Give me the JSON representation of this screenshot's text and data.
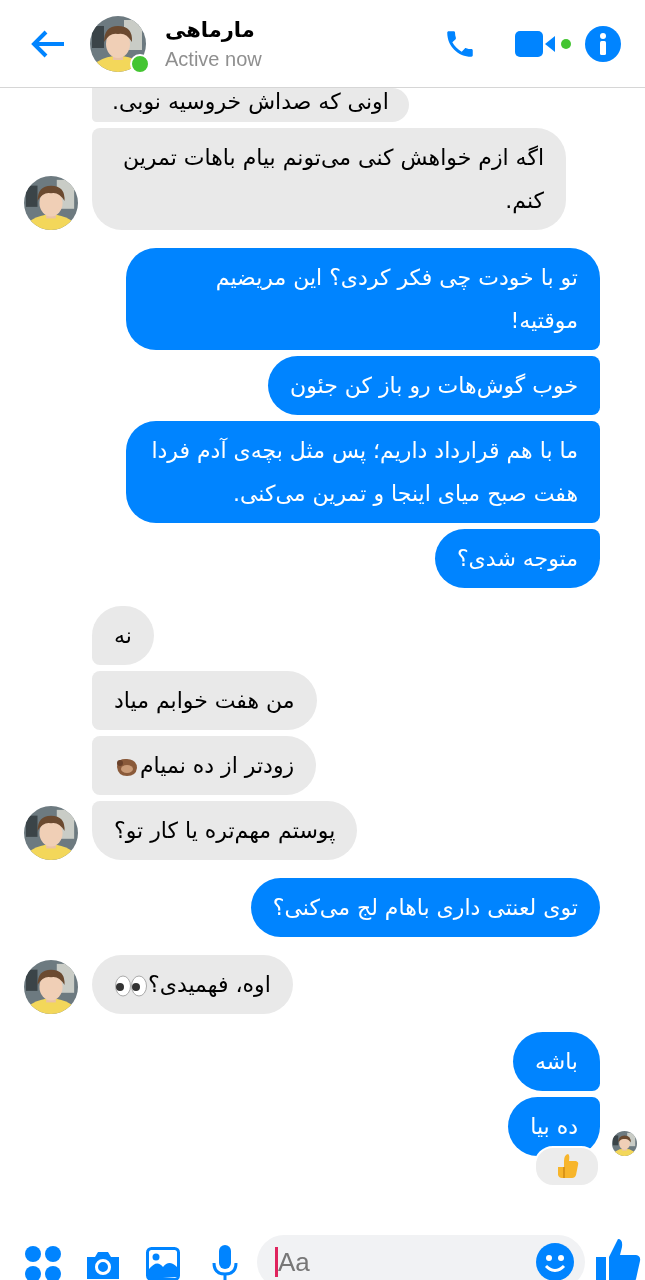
{
  "header": {
    "name": "مارماهی",
    "status": "Active now",
    "online": true
  },
  "messages": [
    {
      "kind": "incoming",
      "text": "اونی که صداش خروسیه نوبی.",
      "avatar": false,
      "seen": false,
      "reaction": false
    },
    {
      "kind": "incoming",
      "text": "اگه ازم خواهش کنی می‌تونم بیام باهات تمرین کنم.",
      "avatar": true,
      "seen": false,
      "reaction": false
    },
    {
      "kind": "outgoing",
      "text": "تو با خودت چی فکر کردی؟ این مریضیم موقتیه!",
      "avatar": false,
      "seen": false,
      "reaction": false
    },
    {
      "kind": "outgoing",
      "text": "خوب گوش‌هات رو باز کن جئون",
      "avatar": false,
      "seen": false,
      "reaction": false
    },
    {
      "kind": "outgoing",
      "text": "ما با هم قرارداد داریم؛ پس مثل بچه‌ی آدم فردا هفت صبح میای اینجا و تمرین می‌کنی.",
      "avatar": false,
      "seen": false,
      "reaction": false
    },
    {
      "kind": "outgoing",
      "text": "متوجه شدی؟",
      "avatar": false,
      "seen": false,
      "reaction": false
    },
    {
      "kind": "incoming",
      "text": "نه",
      "avatar": false,
      "seen": false,
      "reaction": false
    },
    {
      "kind": "incoming",
      "text": "من هفت خوابم میاد",
      "avatar": false,
      "seen": false,
      "reaction": false
    },
    {
      "kind": "incoming",
      "text": "زودتر از ده نمیام",
      "emoji": {
        "kind": "otter"
      },
      "avatar": false,
      "seen": false,
      "reaction": false
    },
    {
      "kind": "incoming",
      "text": "پوستم مهم‌تره یا کار تو؟",
      "avatar": true,
      "seen": false,
      "reaction": false
    },
    {
      "kind": "outgoing",
      "text": "توی لعنتی داری باهام لج می‌کنی؟",
      "avatar": false,
      "seen": false,
      "reaction": false
    },
    {
      "kind": "incoming",
      "text": "اوه، فهمیدی؟",
      "emoji": {
        "kind": "eyes"
      },
      "avatar": true,
      "seen": false,
      "reaction": false
    },
    {
      "kind": "outgoing",
      "text": "باشه",
      "avatar": false,
      "seen": false,
      "reaction": false
    },
    {
      "kind": "outgoing",
      "text": "ده بیا",
      "avatar": false,
      "seen": true,
      "reaction": true
    }
  ],
  "composer": {
    "placeholder": "Aa"
  }
}
